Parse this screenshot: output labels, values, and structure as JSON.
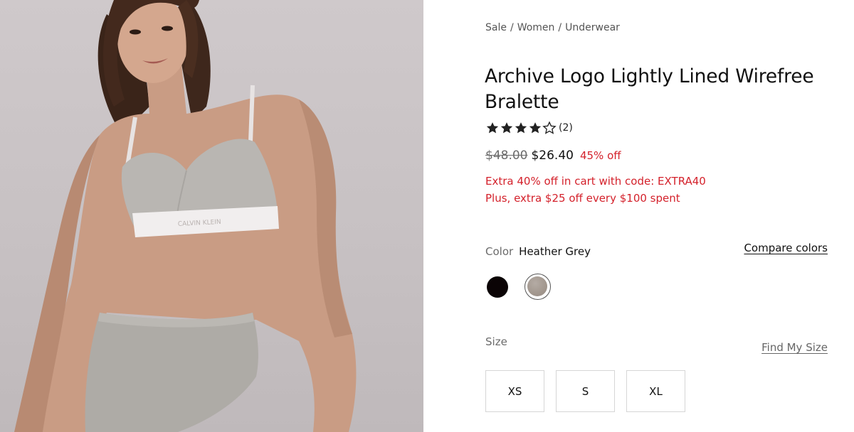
{
  "breadcrumb": {
    "items": [
      "Sale",
      "Women",
      "Underwear"
    ],
    "separator": "/"
  },
  "product": {
    "title": "Archive Logo Lightly Lined Wirefree Bralette",
    "rating": {
      "value": 4,
      "max": 5,
      "count_text": "(2)"
    },
    "price": {
      "original": "$48.00",
      "sale": "$26.40",
      "discount": "45% off"
    },
    "promos": [
      "Extra 40% off in cart with code: EXTRA40",
      "Plus, extra $25 off every $100 spent"
    ]
  },
  "color": {
    "label": "Color",
    "selected": "Heather Grey",
    "compare_link": "Compare colors",
    "swatches": [
      {
        "name": "Black",
        "hex": "#0b0405",
        "selected": false
      },
      {
        "name": "Heather Grey",
        "hex": "#a2978e",
        "selected": true
      }
    ]
  },
  "size": {
    "label": "Size",
    "find_link": "Find My Size",
    "options": [
      "XS",
      "S",
      "XL"
    ]
  },
  "image": {
    "band_text": "CALVIN KLEIN"
  },
  "colors": {
    "accent_red": "#d4212b",
    "text_primary": "#111111",
    "text_muted": "#6b6b6b"
  }
}
